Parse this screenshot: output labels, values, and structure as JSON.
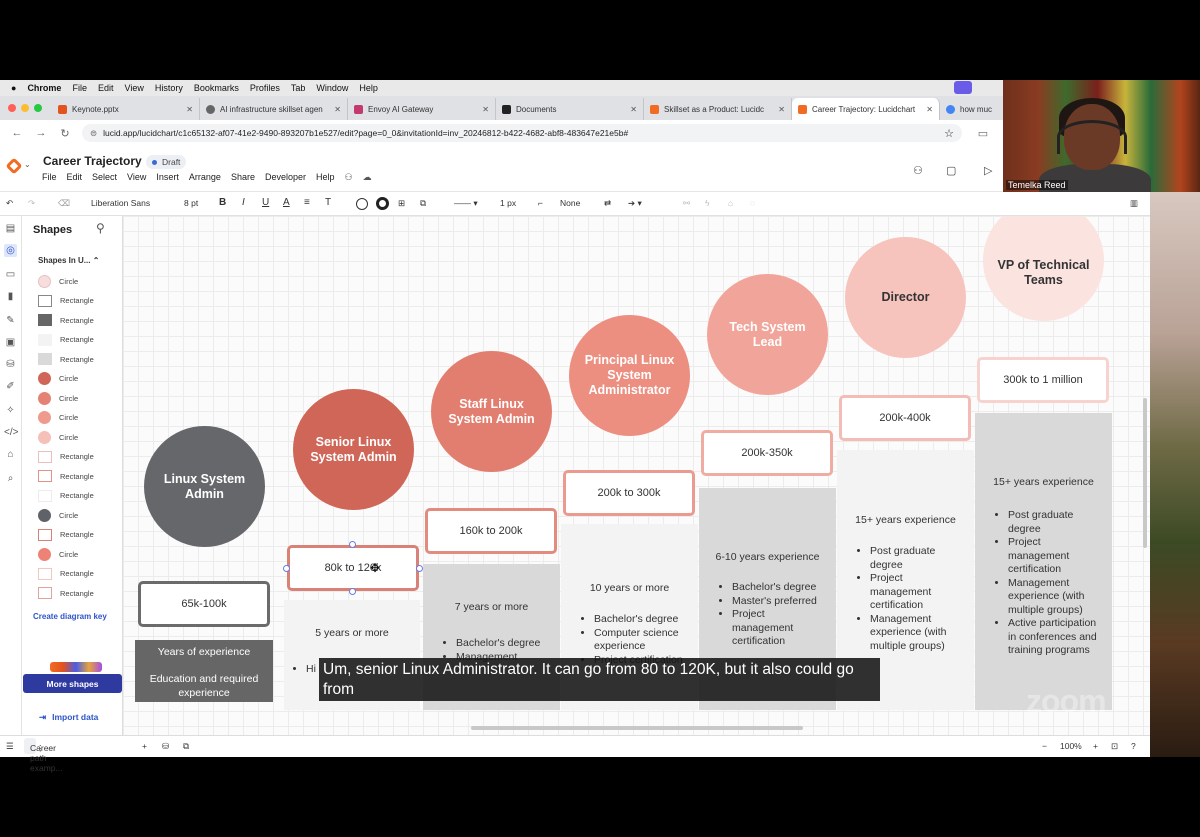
{
  "menubar": {
    "apple": "",
    "app": "Chrome",
    "items": [
      "File",
      "Edit",
      "View",
      "History",
      "Bookmarks",
      "Profiles",
      "Tab",
      "Window",
      "Help"
    ]
  },
  "tabs": [
    {
      "label": "Keynote.pptx",
      "color": "#e2531f"
    },
    {
      "label": "AI infrastructure skillset agen",
      "color": "#666"
    },
    {
      "label": "Envoy AI Gateway",
      "color": "#c23a6e"
    },
    {
      "label": "Documents",
      "color": "#222"
    },
    {
      "label": "Skillset as a Product: Lucidc",
      "color": "#f26b22"
    },
    {
      "label": "Career Trajectory: Lucidchart",
      "color": "#f26b22",
      "active": true
    },
    {
      "label": "how muc",
      "color": "#4285f4"
    }
  ],
  "address": {
    "url": "lucid.app/lucidchart/c1c65132-af07-41e2-9490-893207b1e527/edit?page=0_0&invitationId=inv_20246812-b422-4682-abf8-483647e21e5b#"
  },
  "document": {
    "title": "Career Trajectory",
    "status": "Draft"
  },
  "app_menu": [
    "File",
    "Edit",
    "Select",
    "View",
    "Insert",
    "Arrange",
    "Share",
    "Developer",
    "Help"
  ],
  "toolbar": {
    "font": "Liberation Sans",
    "font_size": "8 pt",
    "bold": "B",
    "italic": "I",
    "underline": "U",
    "text_color": "A",
    "align": "≡",
    "text_options": "T",
    "stroke_width": "1 px",
    "line_end": "None"
  },
  "shapes_panel": {
    "title": "Shapes",
    "section": "Shapes In U...",
    "items": [
      {
        "label": "Circle",
        "kind": "circle",
        "fill": "#f8dddd",
        "border": "#e6c2c2"
      },
      {
        "label": "Rectangle",
        "kind": "rect",
        "fill": "#ffffff",
        "border": "#888888"
      },
      {
        "label": "Rectangle",
        "kind": "rect",
        "fill": "#666666",
        "border": "#666666"
      },
      {
        "label": "Rectangle",
        "kind": "rect",
        "fill": "#f3f3f3",
        "border": "#f3f3f3"
      },
      {
        "label": "Rectangle",
        "kind": "rect",
        "fill": "#d9d9d9",
        "border": "#d9d9d9"
      },
      {
        "label": "Circle",
        "kind": "circle",
        "fill": "#cf6658",
        "border": "#cf6658"
      },
      {
        "label": "Circle",
        "kind": "circle",
        "fill": "#e48374",
        "border": "#e48374"
      },
      {
        "label": "Circle",
        "kind": "circle",
        "fill": "#ee9a8d",
        "border": "#ee9a8d"
      },
      {
        "label": "Circle",
        "kind": "circle",
        "fill": "#f4c0b8",
        "border": "#f4c0b8"
      },
      {
        "label": "Rectangle",
        "kind": "rect",
        "fill": "#ffffff",
        "border": "#e9c0bb"
      },
      {
        "label": "Rectangle",
        "kind": "rect",
        "fill": "#ffffff",
        "border": "#e09389"
      },
      {
        "label": "Rectangle",
        "kind": "rect",
        "fill": "#ffffff",
        "border": "#ececec"
      },
      {
        "label": "Circle",
        "kind": "circle",
        "fill": "#5f6368",
        "border": "#5f6368"
      },
      {
        "label": "Rectangle",
        "kind": "rect",
        "fill": "#ffffff",
        "border": "#d88176"
      },
      {
        "label": "Circle",
        "kind": "circle",
        "fill": "#ec8376",
        "border": "#ec8376"
      },
      {
        "label": "Rectangle",
        "kind": "rect",
        "fill": "#ffffff",
        "border": "#f0c8c2"
      },
      {
        "label": "Rectangle",
        "kind": "rect",
        "fill": "#ffffff",
        "border": "#e2a39a"
      }
    ],
    "create_key": "Create diagram key",
    "more_shapes": "More shapes",
    "import_data": "Import data"
  },
  "diagram": {
    "roles": [
      {
        "title": "Linux System Admin",
        "color": "#66676b",
        "text_color": "#ffffff"
      },
      {
        "title": "Senior Linux System Admin",
        "color": "#cf6658",
        "text_color": "#ffffff"
      },
      {
        "title": "Staff Linux System Admin",
        "color": "#e27e6f",
        "text_color": "#ffffff"
      },
      {
        "title": "Principal Linux System Administrator",
        "color": "#ec8f81",
        "text_color": "#ffffff"
      },
      {
        "title": "Tech System Lead",
        "color": "#f1a59a",
        "text_color": "#ffffff"
      },
      {
        "title": "Director",
        "color": "#f6c3bd",
        "text_color": "#333333"
      },
      {
        "title": "VP of Technical Teams",
        "color": "#fbe3df",
        "text_color": "#333333"
      }
    ],
    "salaries": [
      "65k-100k",
      "80k to 120k",
      "160k to 200k",
      "200k to 300k",
      "200k-350k",
      "200k-400k",
      "300k to 1 million"
    ],
    "legend": {
      "experience": "Years of experience",
      "education": "Education and required experience"
    },
    "columns": [
      {
        "experience": "5 years or more",
        "bullets": [
          "Hi"
        ]
      },
      {
        "experience": "7 years or more",
        "bullets": [
          "Bachelor's degree",
          "Management"
        ]
      },
      {
        "experience": "10 years or more",
        "bullets": [
          "Bachelor's degree",
          "Computer science experience",
          "Project certification"
        ]
      },
      {
        "experience": "6-10 years experience",
        "bullets": [
          "Bachelor's degree",
          "Master's preferred",
          "Project management certification"
        ]
      },
      {
        "experience": "15+ years experience",
        "bullets": [
          "Post graduate degree",
          "Project management certification",
          "Management experience (with multiple groups)"
        ]
      },
      {
        "experience": "15+ years experience",
        "bullets": [
          "Post graduate degree",
          "Project management certification",
          "Management experience (with multiple groups)",
          "Active participation in conferences and training programs"
        ]
      }
    ]
  },
  "statusbar": {
    "page": "Career path examp...",
    "zoom": "100%"
  },
  "caption": "Um, senior Linux Administrator. It can go from 80 to 120K, but it also could go from",
  "webcam": {
    "name": "Temelka Reed"
  },
  "watermark": "zoom"
}
